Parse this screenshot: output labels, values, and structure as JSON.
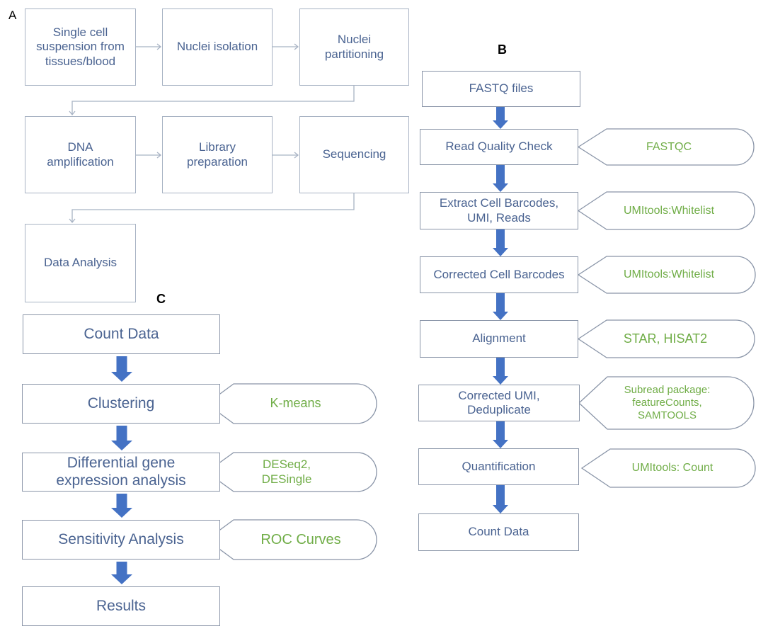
{
  "panels": {
    "a": {
      "label": "A",
      "steps": [
        "Single cell suspension from tissues/blood",
        "Nuclei isolation",
        "Nuclei partitioning",
        "DNA amplification",
        "Library preparation",
        "Sequencing",
        "Data Analysis"
      ]
    },
    "b": {
      "label": "B",
      "steps": [
        "FASTQ files",
        "Read Quality Check",
        "Extract Cell Barcodes, UMI, Reads",
        "Corrected Cell Barcodes",
        "Alignment",
        "Corrected UMI, Deduplicate",
        "Quantification",
        "Count Data"
      ],
      "tools": [
        "",
        "FASTQC",
        "UMItools:Whitelist",
        "UMItools:Whitelist",
        "STAR, HISAT2",
        "Subread package: featureCounts, SAMTOOLS",
        "UMItools: Count",
        ""
      ]
    },
    "c": {
      "label": "C",
      "steps": [
        "Count Data",
        "Clustering",
        "Differential gene expression analysis",
        "Sensitivity Analysis",
        "Results"
      ],
      "tools": [
        "",
        "K-means",
        "DESeq2, DESingle",
        "ROC Curves",
        ""
      ]
    }
  },
  "colors": {
    "box_text": "#4a6391",
    "tool_text": "#70ad47",
    "block_arrow": "#4472c4",
    "connector": "#a8b3c4"
  }
}
